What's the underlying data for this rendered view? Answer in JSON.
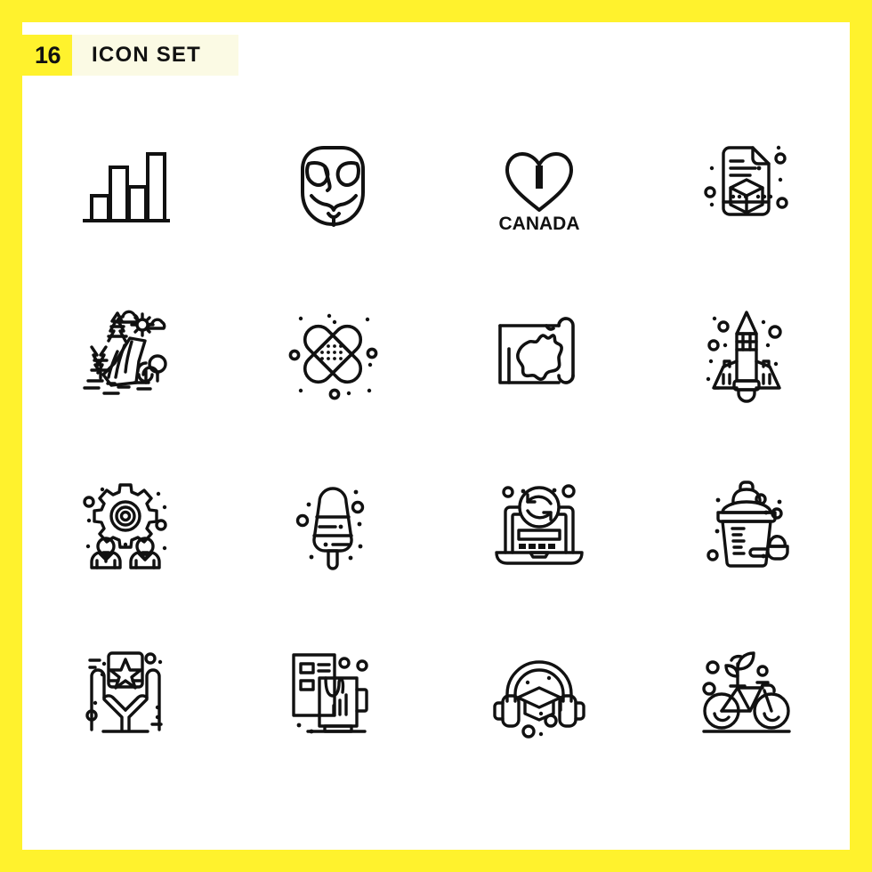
{
  "header": {
    "count": "16",
    "title": "ICON SET",
    "badge_color": "#FFF22D",
    "title_bg_color": "#FBFAE4",
    "text_color": "#111111"
  },
  "page": {
    "border_color": "#FFF22D",
    "background_color": "#FFFFFF",
    "icon_stroke_color": "#111111",
    "rows": 4,
    "columns": 4
  },
  "icons": [
    {
      "index": 1,
      "name": "bar-chart-icon",
      "label": "Bar Chart"
    },
    {
      "index": 2,
      "name": "anonymous-mask-icon",
      "label": "Anonymous Mask"
    },
    {
      "index": 3,
      "name": "i-love-canada-icon",
      "label": "I Love Canada",
      "text": "CANADA",
      "heart_letter": "I"
    },
    {
      "index": 4,
      "name": "3d-file-document-icon",
      "label": "3D File Document"
    },
    {
      "index": 5,
      "name": "waterfall-landscape-icon",
      "label": "Waterfall Landscape"
    },
    {
      "index": 6,
      "name": "crossed-bandage-icon",
      "label": "Crossed Bandages"
    },
    {
      "index": 7,
      "name": "australia-map-scroll-icon",
      "label": "Australia Map Scroll"
    },
    {
      "index": 8,
      "name": "space-shuttle-icon",
      "label": "Space Shuttle"
    },
    {
      "index": 9,
      "name": "team-management-gear-icon",
      "label": "Team Management"
    },
    {
      "index": 10,
      "name": "ice-cream-popsicle-icon",
      "label": "Ice Cream Popsicle"
    },
    {
      "index": 11,
      "name": "laptop-sync-icon",
      "label": "Laptop Sync"
    },
    {
      "index": 12,
      "name": "protein-shaker-icon",
      "label": "Protein Shaker"
    },
    {
      "index": 13,
      "name": "hands-holding-star-icon",
      "label": "Hands Holding Star"
    },
    {
      "index": 14,
      "name": "branding-mockup-icon",
      "label": "Branding Mockup"
    },
    {
      "index": 15,
      "name": "headphones-graduation-icon",
      "label": "Audio Learning"
    },
    {
      "index": 16,
      "name": "eco-bicycle-icon",
      "label": "Eco Bicycle"
    }
  ]
}
